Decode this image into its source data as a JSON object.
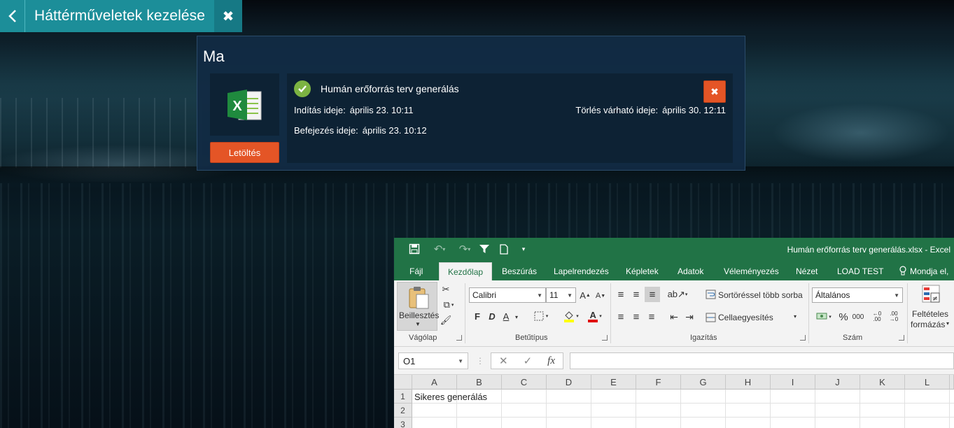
{
  "header": {
    "title": "Háttérműveletek kezelése"
  },
  "panel": {
    "heading": "Ma",
    "download_label": "Letöltés",
    "job": {
      "name": "Humán erőforrás terv generálás",
      "start_label": "Indítás ideje:",
      "start_value": "április 23. 10:11",
      "end_label": "Befejezés ideje:",
      "end_value": "április 23. 10:12",
      "delete_label": "Törlés várható ideje:",
      "delete_value": "április 30. 12:11",
      "status": "success"
    }
  },
  "excel": {
    "title": "Humán erőforrás terv generálás.xlsx - Excel",
    "tabs": [
      "Fájl",
      "Kezdőlap",
      "Beszúrás",
      "Lapelrendezés",
      "Képletek",
      "Adatok",
      "Véleményezés",
      "Nézet",
      "LOAD TEST",
      "Mondja el,"
    ],
    "active_tab": "Kezdőlap",
    "ribbon": {
      "paste_label": "Beillesztés",
      "clipboard_label": "Vágólap",
      "font_label": "Betűtípus",
      "font_name": "Calibri",
      "font_size": "11",
      "bold": "F",
      "italic": "D",
      "underline": "A",
      "alignment_label": "Igazítás",
      "wrap_label": "Sortöréssel több sorba",
      "merge_label": "Cellaegyesítés",
      "number_label": "Szám",
      "number_format": "Általános",
      "percent": "%",
      "thousands": "000",
      "conditional_label_1": "Feltételes",
      "conditional_label_2": "formázás"
    },
    "name_box": "O1",
    "columns": [
      "A",
      "B",
      "C",
      "D",
      "E",
      "F",
      "G",
      "H",
      "I",
      "J",
      "K",
      "L"
    ],
    "rows": [
      "1",
      "2",
      "3"
    ],
    "cell_a1": "Sikeres generálás"
  },
  "colors": {
    "header_teal": "#1c8e99",
    "accent_orange": "#e45526",
    "success_green": "#7cb342",
    "excel_green": "#217346",
    "panel_bg": "#122b44"
  }
}
